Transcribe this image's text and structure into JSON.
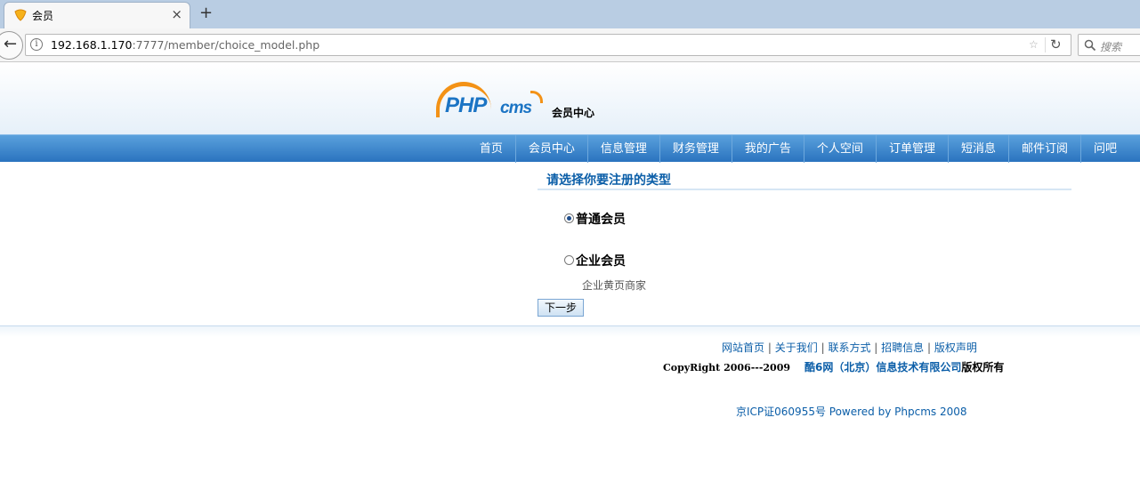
{
  "browser": {
    "tab_title": "会员",
    "new_tab_symbol": "+",
    "close_symbol": "×",
    "url_host": "192.168.1.170",
    "url_rest": ":7777/member/choice_model.php",
    "search_placeholder": "搜索"
  },
  "header": {
    "logo_php": "PHP",
    "logo_cms": "cms",
    "logo_sub": "会员中心"
  },
  "menu": {
    "items": [
      "首页",
      "会员中心",
      "信息管理",
      "财务管理",
      "我的广告",
      "个人空间",
      "订单管理",
      "短消息",
      "邮件订阅",
      "问吧"
    ]
  },
  "main": {
    "section_title": "请选择你要注册的类型",
    "options": [
      {
        "label": "普通会员",
        "checked": true
      },
      {
        "label": "企业会员",
        "checked": false
      }
    ],
    "enterprise_desc": "企业黄页商家",
    "next_button": "下一步"
  },
  "footer": {
    "links": [
      "网站首页",
      "关于我们",
      "联系方式",
      "招聘信息",
      "版权声明"
    ],
    "separator": "|",
    "copyright_en": "CopyRight 2006---2009",
    "company": "酷6网（北京）信息技术有限公司",
    "rights": "版权所有",
    "icp": "京ICP证060955号 Powered by Phpcms 2008"
  },
  "colors": {
    "menu_bar": "#2a73bf",
    "link_blue": "#0b5ea8",
    "logo_orange": "#f39216"
  }
}
